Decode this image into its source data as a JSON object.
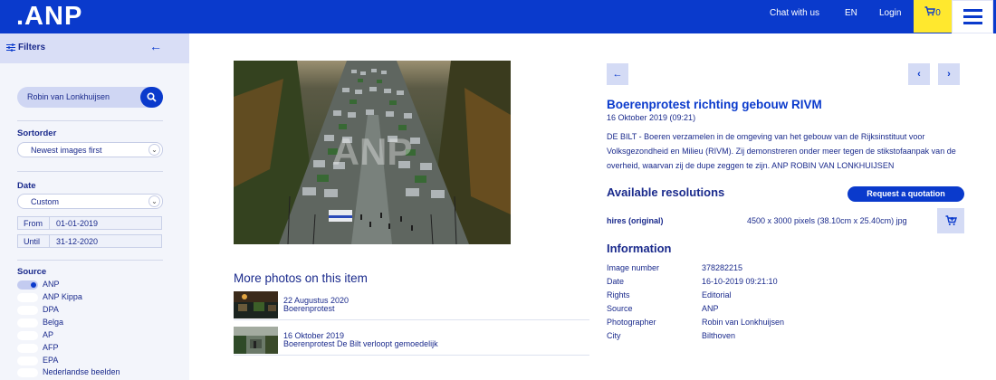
{
  "header": {
    "logo": ".ANP",
    "chat": "Chat with us",
    "lang": "EN",
    "login": "Login",
    "cart_count": "0"
  },
  "sidebar": {
    "filters_label": "Filters",
    "search_value": "Robin van Lonkhuijsen",
    "sortorder_label": "Sortorder",
    "sortorder_value": "Newest images first",
    "date_label": "Date",
    "date_value": "Custom",
    "from_label": "From",
    "from_value": "01-01-2019",
    "until_label": "Until",
    "until_value": "31-12-2020",
    "source_label": "Source",
    "sources": [
      {
        "label": "ANP",
        "on": true
      },
      {
        "label": "ANP Kippa",
        "on": false
      },
      {
        "label": "DPA",
        "on": false
      },
      {
        "label": "Belga",
        "on": false
      },
      {
        "label": "AP",
        "on": false
      },
      {
        "label": "AFP",
        "on": false
      },
      {
        "label": "EPA",
        "on": false
      },
      {
        "label": "Nederlandse beelden",
        "on": false
      }
    ]
  },
  "main": {
    "more_title": "More photos on this item",
    "related": [
      {
        "date": "22 Augustus 2020",
        "title": "Boerenprotest"
      },
      {
        "date": "16 Oktober 2019",
        "title": "Boerenprotest De Bilt verloopt gemoedelijk"
      }
    ],
    "title": "Boerenprotest richting gebouw RIVM",
    "date": "16 Oktober 2019 (09:21)",
    "description": "DE BILT - Boeren verzamelen in de omgeving van het gebouw van de Rijksinstituut voor Volksgezondheid en Milieu (RIVM). Zij demonstreren onder meer tegen de stikstofaanpak van de overheid, waarvan zij de dupe zeggen te zijn. ANP ROBIN VAN LONKHUIJSEN",
    "available_resolutions": "Available resolutions",
    "request_quotation": "Request a quotation",
    "resolution": {
      "name": "hires (original)",
      "spec": "4500 x 3000 pixels (38.10cm x 25.40cm)  jpg"
    },
    "information_label": "Information",
    "info": [
      {
        "key": "Image number",
        "value": "378282215"
      },
      {
        "key": "Date",
        "value": "16-10-2019 09:21:10"
      },
      {
        "key": "Rights",
        "value": "Editorial"
      },
      {
        "key": "Source",
        "value": "ANP"
      },
      {
        "key": "Photographer",
        "value": "Robin van Lonkhuijsen"
      },
      {
        "key": "City",
        "value": "Bilthoven"
      }
    ],
    "watermark": "ANP"
  },
  "colors": {
    "brand_blue": "#0a3acc",
    "cart_yellow": "#ffe82e",
    "text_navy": "#1a2a8c"
  },
  "icons": [
    "filter-icon",
    "back-arrow-icon",
    "search-icon",
    "chevron-down-icon",
    "cart-icon",
    "menu-icon",
    "prev-icon",
    "next-icon",
    "add-to-cart-icon"
  ]
}
